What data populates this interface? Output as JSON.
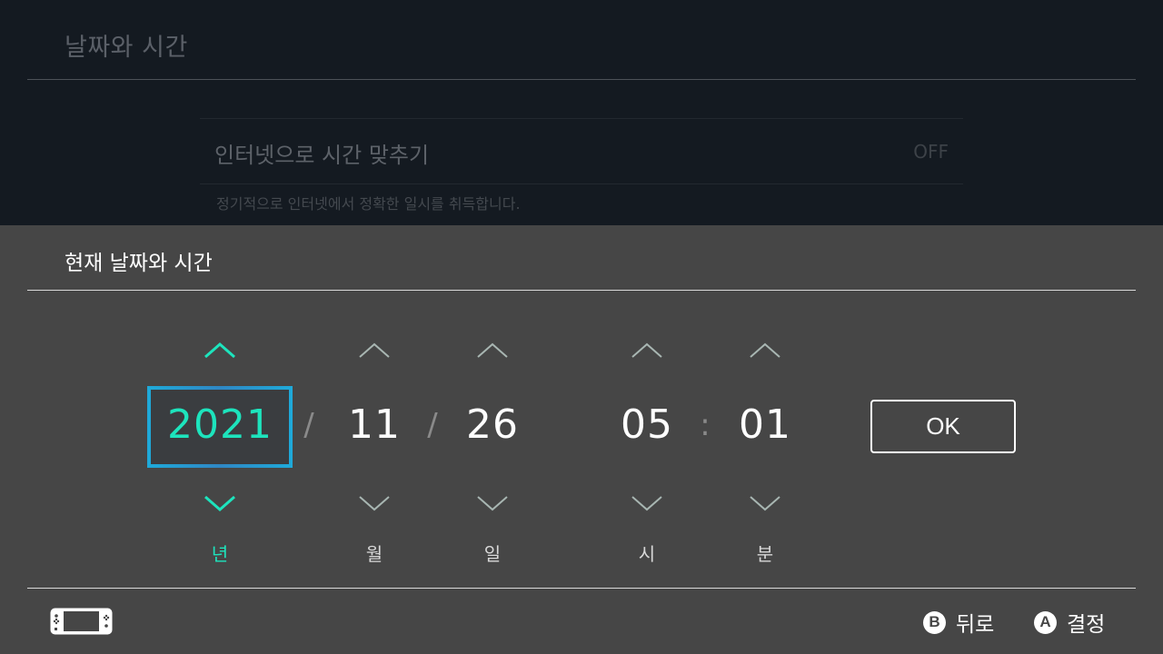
{
  "background": {
    "title": "날짜와 시간",
    "setting_label": "인터넷으로 시간 맞추기",
    "setting_value": "OFF",
    "setting_description": "정기적으로 인터넷에서 정확한 일시를 취득합니다."
  },
  "dialog": {
    "title": "현재 날짜와 시간",
    "fields": {
      "year": {
        "value": "2021",
        "unit": "년"
      },
      "month": {
        "value": "11",
        "unit": "월"
      },
      "day": {
        "value": "26",
        "unit": "일"
      },
      "hour": {
        "value": "05",
        "unit": "시"
      },
      "minute": {
        "value": "01",
        "unit": "분"
      }
    },
    "separators": {
      "date": "/",
      "time": ":"
    },
    "ok_label": "OK",
    "selected_field": "year"
  },
  "footer": {
    "console_icon": "handheld-console-icon",
    "hints": [
      {
        "button": "B",
        "label": "뒤로"
      },
      {
        "button": "A",
        "label": "결정"
      }
    ]
  },
  "colors": {
    "accent": "#1de4bd",
    "selection_border": "#2a9fd6",
    "panel_bg": "#464646",
    "screen_bg": "#141a21"
  }
}
